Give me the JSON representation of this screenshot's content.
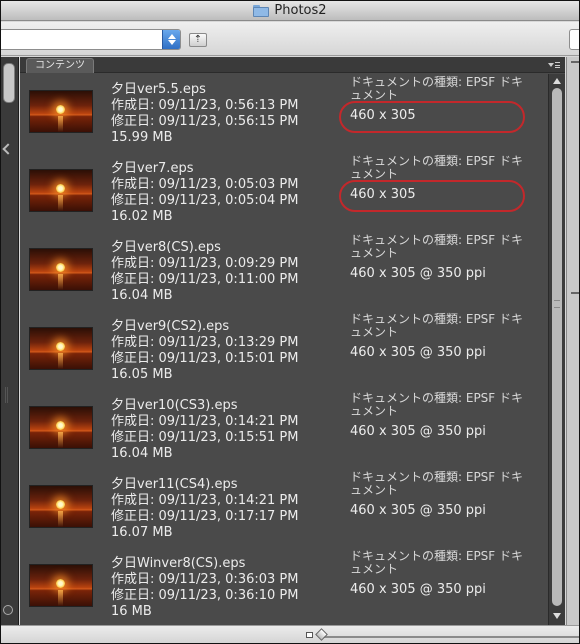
{
  "window": {
    "title": "Photos2"
  },
  "toolbar": {
    "up_folder_glyph": "⇡"
  },
  "panel": {
    "tab_label": "コンテンツ"
  },
  "items": [
    {
      "name": "夕日ver5.5.eps",
      "created": "作成日: 09/11/23, 0:56:13 PM",
      "modified": "修正日: 09/11/23, 0:56:15 PM",
      "size": "15.99 MB",
      "kind": "ドキュメントの種類: EPSF ドキュメント",
      "dimensions": "460 x 305",
      "highlighted": true
    },
    {
      "name": "夕日ver7.eps",
      "created": "作成日: 09/11/23, 0:05:03 PM",
      "modified": "修正日: 09/11/23, 0:05:04 PM",
      "size": "16.02 MB",
      "kind": "ドキュメントの種類: EPSF ドキュメント",
      "dimensions": "460 x 305",
      "highlighted": true
    },
    {
      "name": "夕日ver8(CS).eps",
      "created": "作成日: 09/11/23, 0:09:29 PM",
      "modified": "修正日: 09/11/23, 0:11:00 PM",
      "size": "16.04 MB",
      "kind": "ドキュメントの種類: EPSF ドキュメント",
      "dimensions": "460 x 305 @ 350 ppi",
      "highlighted": false
    },
    {
      "name": "夕日ver9(CS2).eps",
      "created": "作成日: 09/11/23, 0:13:29 PM",
      "modified": "修正日: 09/11/23, 0:15:01 PM",
      "size": "16.05 MB",
      "kind": "ドキュメントの種類: EPSF ドキュメント",
      "dimensions": "460 x 305 @ 350 ppi",
      "highlighted": false
    },
    {
      "name": "夕日ver10(CS3).eps",
      "created": "作成日: 09/11/23, 0:14:21 PM",
      "modified": "修正日: 09/11/23, 0:15:51 PM",
      "size": "16.04 MB",
      "kind": "ドキュメントの種類: EPSF ドキュメント",
      "dimensions": "460 x 305 @ 350 ppi",
      "highlighted": false
    },
    {
      "name": "夕日ver11(CS4).eps",
      "created": "作成日: 09/11/23, 0:14:21 PM",
      "modified": "修正日: 09/11/23, 0:17:17 PM",
      "size": "16.07 MB",
      "kind": "ドキュメントの種類: EPSF ドキュメント",
      "dimensions": "460 x 305 @ 350 ppi",
      "highlighted": false
    },
    {
      "name": "夕日Winver8(CS).eps",
      "created": "作成日: 09/11/23, 0:36:03 PM",
      "modified": "修正日: 09/11/23, 0:36:10 PM",
      "size": "16 MB",
      "kind": "ドキュメントの種類: EPSF ドキュメント",
      "dimensions": "460 x 305 @ 350 ppi",
      "highlighted": false
    }
  ],
  "colors": {
    "highlight_ring": "#c3282b",
    "panel_bg": "#4a4a4a",
    "stepper_blue": "#3d7fd6"
  },
  "icons": {
    "title": "folder-icon",
    "item_thumb": "sunset-thumbnail"
  }
}
